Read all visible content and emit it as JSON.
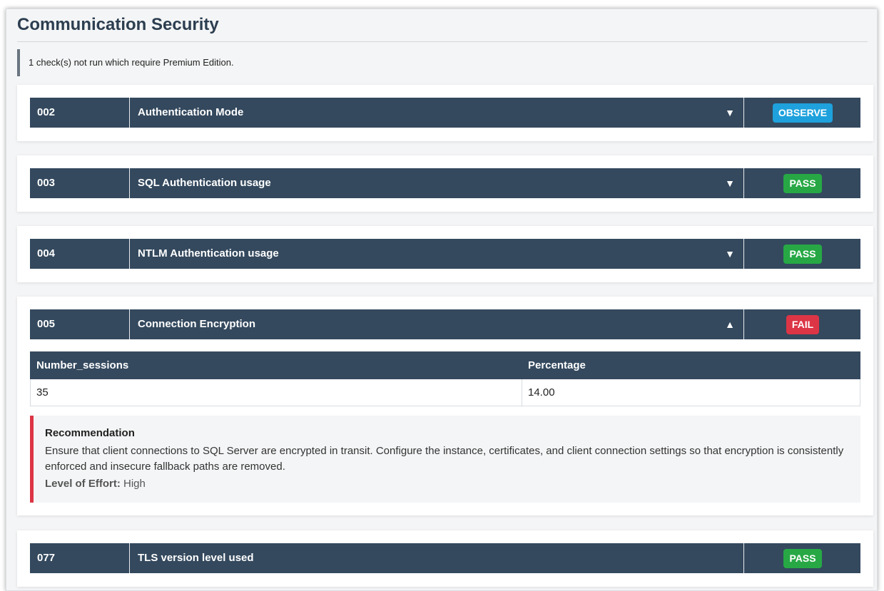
{
  "section": {
    "title": "Communication Security",
    "notice": "1 check(s) not run which require Premium Edition."
  },
  "checks": [
    {
      "id": "002",
      "name": "Authentication Mode",
      "status": "OBSERVE",
      "toggle": "▼"
    },
    {
      "id": "003",
      "name": "SQL Authentication usage",
      "status": "PASS",
      "toggle": "▼"
    },
    {
      "id": "004",
      "name": "NTLM Authentication usage",
      "status": "PASS",
      "toggle": "▼"
    },
    {
      "id": "005",
      "name": "Connection Encryption",
      "status": "FAIL",
      "toggle": "▲",
      "table": {
        "headers": [
          "Number_sessions",
          "Percentage"
        ],
        "rows": [
          [
            "35",
            "14.00"
          ]
        ]
      },
      "recommendation": {
        "title": "Recommendation",
        "text": "Ensure that client connections to SQL Server are encrypted in transit. Configure the instance, certificates, and client connection settings so that encryption is consistently enforced and insecure fallback paths are removed.",
        "effort_label": "Level of Effort:",
        "effort_value": "High"
      }
    },
    {
      "id": "077",
      "name": "TLS version level used",
      "status": "PASS",
      "toggle": ""
    }
  ],
  "colors": {
    "header_bg": "#34495e",
    "observe": "#1ea1dc",
    "pass": "#27a845",
    "fail": "#dc3545"
  }
}
